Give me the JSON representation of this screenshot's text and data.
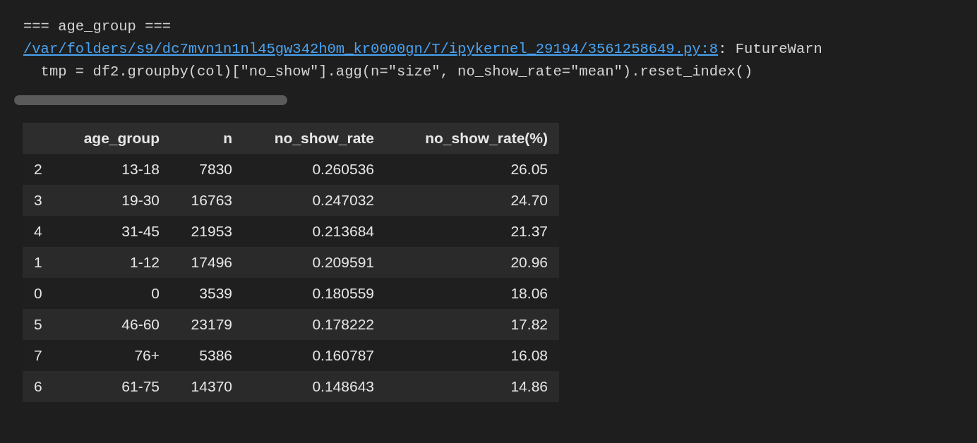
{
  "output": {
    "heading": "=== age_group ===",
    "warning_path": "/var/folders/s9/dc7mvn1n1nl45gw342h0m_kr0000gn/T/ipykernel_29194/3561258649.py:8",
    "warning_text": ": FutureWarn",
    "code_line": "  tmp = df2.groupby(col)[\"no_show\"].agg(n=\"size\", no_show_rate=\"mean\").reset_index()"
  },
  "table": {
    "columns": [
      "",
      "age_group",
      "n",
      "no_show_rate",
      "no_show_rate(%)"
    ],
    "rows": [
      [
        "2",
        "13-18",
        "7830",
        "0.260536",
        "26.05"
      ],
      [
        "3",
        "19-30",
        "16763",
        "0.247032",
        "24.70"
      ],
      [
        "4",
        "31-45",
        "21953",
        "0.213684",
        "21.37"
      ],
      [
        "1",
        "1-12",
        "17496",
        "0.209591",
        "20.96"
      ],
      [
        "0",
        "0",
        "3539",
        "0.180559",
        "18.06"
      ],
      [
        "5",
        "46-60",
        "23179",
        "0.178222",
        "17.82"
      ],
      [
        "7",
        "76+",
        "5386",
        "0.160787",
        "16.08"
      ],
      [
        "6",
        "61-75",
        "14370",
        "0.148643",
        "14.86"
      ]
    ]
  }
}
